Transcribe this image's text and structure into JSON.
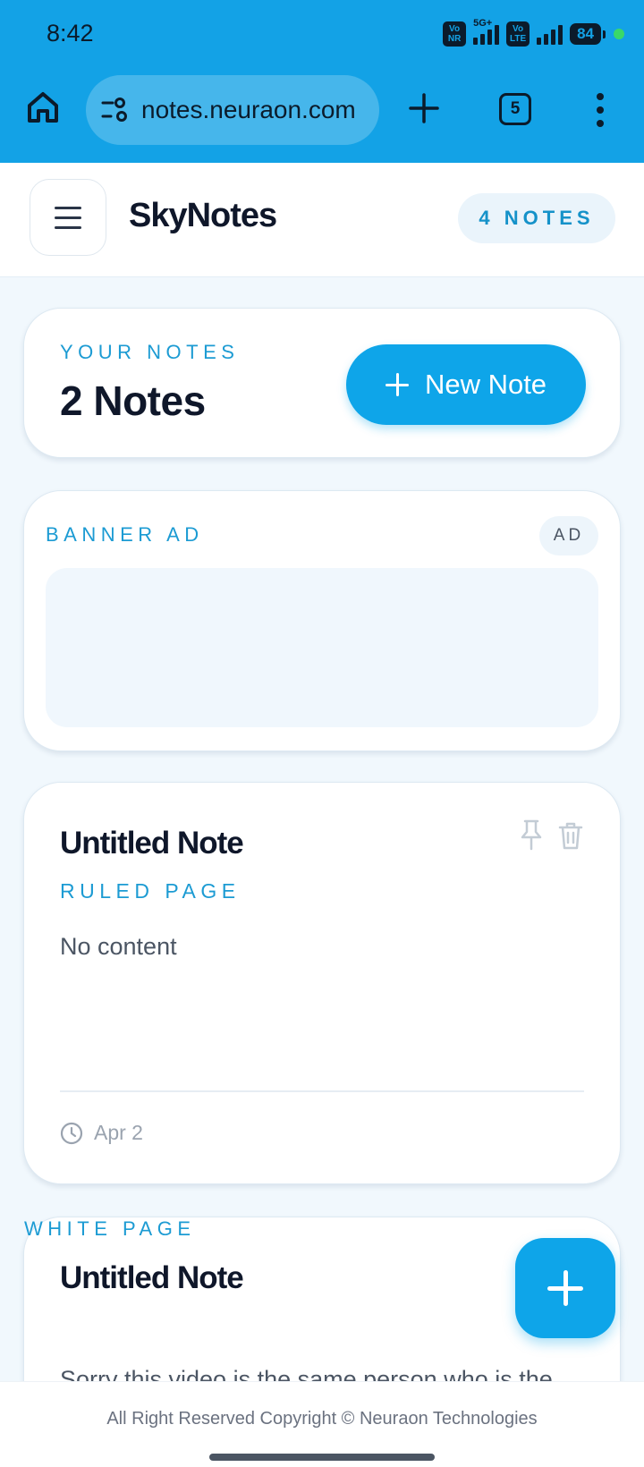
{
  "status": {
    "time": "8:42",
    "sim1": "Vo NR",
    "net1": "5G+",
    "sim2": "Vo LTE",
    "battery": "84"
  },
  "browser": {
    "url": "notes.neuraon.com",
    "tab_count": "5",
    "icons": [
      "home-icon",
      "site-settings-icon",
      "new-tab-icon",
      "tabs-icon",
      "more-menu-icon"
    ]
  },
  "header": {
    "title": "SkyNotes",
    "notes_badge": "4 NOTES"
  },
  "summary": {
    "eyebrow": "YOUR NOTES",
    "count": "2 Notes",
    "new_note_label": "New Note"
  },
  "ad": {
    "label": "BANNER AD",
    "badge": "AD"
  },
  "notes": [
    {
      "title": "Untitled Note",
      "page_type": "RULED PAGE",
      "content": "No content",
      "date": "Apr 2"
    },
    {
      "title": "Untitled Note",
      "page_type": "WHITE PAGE",
      "content": "Sorry this video is the same person who is the"
    }
  ],
  "footer": {
    "copyright": "All Right Reserved Copyright © Neuraon Technologies"
  },
  "colors": {
    "browser_bar": "#13a2e6",
    "accent": "#0ea5e9",
    "eyebrow": "#1c9bd3",
    "background": "#f1f8fd"
  }
}
